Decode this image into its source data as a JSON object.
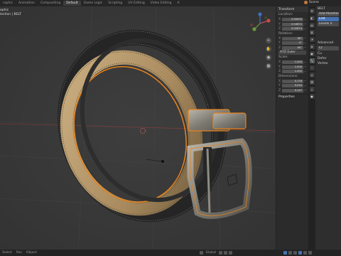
{
  "topbar": {
    "tabs": [
      "raphic",
      "Animation",
      "Compositing",
      "Default",
      "Game Logic",
      "Scripting",
      "UV Editing",
      "Video Editing",
      "A"
    ],
    "active_index": 3,
    "scene": "Scene"
  },
  "viewport": {
    "info_line1": "aphic",
    "info_line2": "lection | BELT"
  },
  "npanel": {
    "header": "Transform",
    "location_label": "Location:",
    "location": [
      {
        "axis": "X",
        "value": "0.00000"
      },
      {
        "axis": "Y",
        "value": "0.54872"
      },
      {
        "axis": "Z",
        "value": "0.02674"
      }
    ],
    "rotation_label": "Rotation:",
    "rotation": [
      {
        "axis": "X",
        "value": "90°"
      },
      {
        "axis": "Y",
        "value": "0°"
      },
      {
        "axis": "Z",
        "value": "90°"
      }
    ],
    "rotation_mode": "XYZ Euler",
    "scale_label": "Scale:",
    "scale": [
      {
        "axis": "X",
        "value": "1.000"
      },
      {
        "axis": "Y",
        "value": "1.000"
      },
      {
        "axis": "Z",
        "value": "1.000"
      }
    ],
    "dimensions_label": "Dimensions:",
    "dimensions": [
      {
        "axis": "X",
        "value": "0.176"
      },
      {
        "axis": "Y",
        "value": "0.034"
      },
      {
        "axis": "Z",
        "value": "0.147"
      }
    ],
    "properties_section": "Properties"
  },
  "properties": {
    "object_name": "BELT",
    "add_modifier": "Add Modifier",
    "btn_mode": "Edit",
    "btn_apply": "Levels V",
    "advanced": "Advanced",
    "row1": "Cr",
    "row2": "Cu",
    "row3": "Defor",
    "row4": "Vertex"
  },
  "statusbar": {
    "items": [
      "Select",
      "Pan",
      "Object"
    ],
    "center_label": "Global"
  },
  "colors": {
    "accent": "#4772b3",
    "selection_outline": "#e8831b",
    "leather": "#262626",
    "inner": "#b89a6a",
    "buckle": "#8d8a80"
  }
}
